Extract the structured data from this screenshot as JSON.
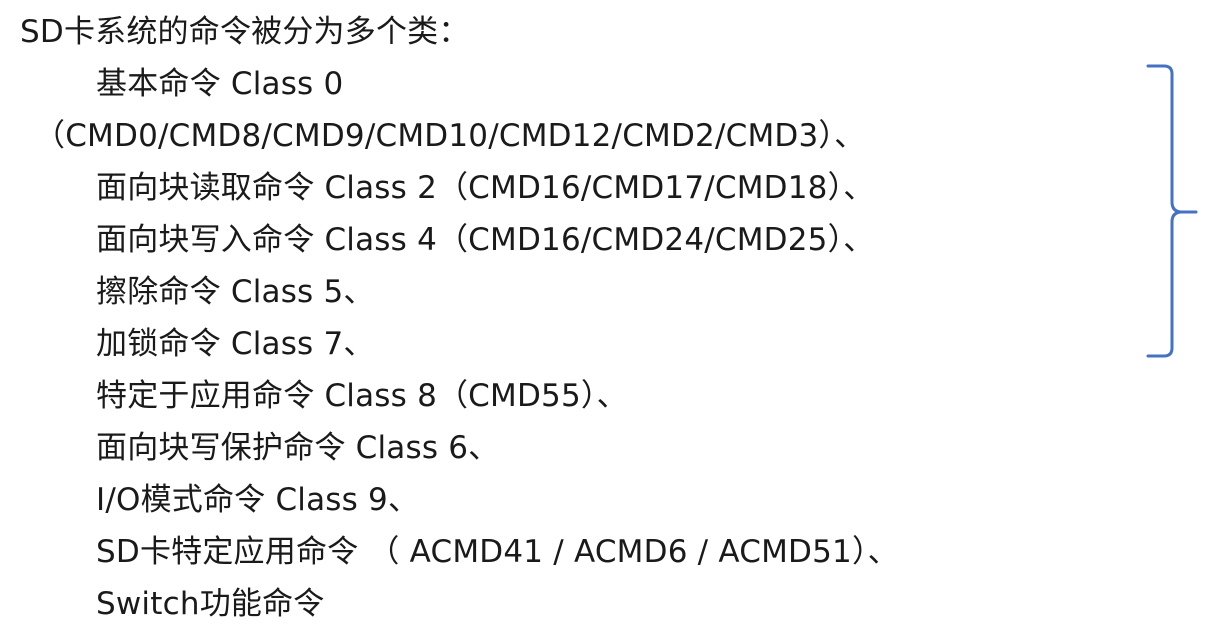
{
  "slide": {
    "heading": "SD卡系统的命令被分为多个类：",
    "lines": [
      "基本命令 Class 0",
      "（CMD0/CMD8/CMD9/CMD10/CMD12/CMD2/CMD3）、",
      "面向块读取命令 Class 2（CMD16/CMD17/CMD18）、",
      "面向块写入命令 Class 4（CMD16/CMD24/CMD25）、",
      "擦除命令 Class 5、",
      "加锁命令 Class 7、",
      "特定于应用命令 Class 8（CMD55）、",
      "面向块写保护命令 Class 6、",
      "I/O模式命令 Class 9、",
      "SD卡特定应用命令 （ ACMD41 / ACMD6 / ACMD51）、",
      "Switch功能命令"
    ]
  },
  "colors": {
    "text": "#1a1a1a",
    "brace": "#4472c4",
    "background": "#ffffff"
  },
  "icons": {
    "brace": "right-curly-brace-icon"
  }
}
